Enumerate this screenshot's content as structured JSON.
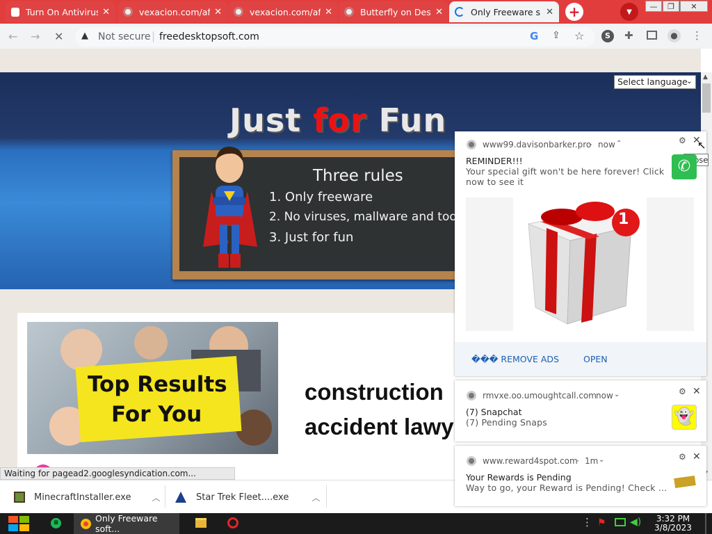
{
  "tabs": [
    {
      "title": "Turn On Antivirus",
      "color": "#e23d3d"
    },
    {
      "title": "vexacion.com/af",
      "color": "#e23d3d"
    },
    {
      "title": "vexacion.com/af",
      "color": "#e23d3d"
    },
    {
      "title": "Butterfly on Desk",
      "color": "#e23d3d"
    },
    {
      "title": "Only Freeware s",
      "active": true
    }
  ],
  "toolbar": {
    "security_label": "Not secure",
    "url": "freedesktopsoft.com",
    "profile_letter": "S"
  },
  "page": {
    "language_select": "Select language",
    "banner_title_1": "Just ",
    "banner_title_2": "for",
    "banner_title_3": " Fun",
    "rules_title": "Three rules",
    "rule_1": "1. Only freeware",
    "rule_2": "2. No viruses, mallware and toolbars",
    "rule_3": "3. Just for fun",
    "promo_line_1": "Top Results",
    "promo_line_2": "For You",
    "headline_1": "construction",
    "headline_2": "accident lawy",
    "status": "Waiting for pagead2.googlesyndication.com..."
  },
  "notifications": [
    {
      "origin": "www99.davisonbarker.pro",
      "time": "now",
      "title": "REMINDER!!!",
      "body_1": "Your special gift won't be here forever! Click",
      "body_2": "now to see it",
      "badge_number": "1",
      "button_1": "��� REMOVE ADS",
      "button_2": "OPEN",
      "tooltip": "Close"
    },
    {
      "origin": "rmvxe.oo.umoughtcall.com",
      "time": "now",
      "title": "(7) Snapchat",
      "body": "(7) Pending Snaps"
    },
    {
      "origin": "www.reward4spot.com",
      "time": "1m",
      "title": "Your Rewards is Pending",
      "body": "Way to go, your Reward is Pending! Check ..."
    }
  ],
  "downloads": [
    {
      "name": "MinecraftInstaller.exe"
    },
    {
      "name": "Star Trek Fleet....exe"
    }
  ],
  "taskbar": {
    "chrome_task": "Only Freeware soft...",
    "time": "3:32 PM",
    "date": "3/8/2023"
  }
}
